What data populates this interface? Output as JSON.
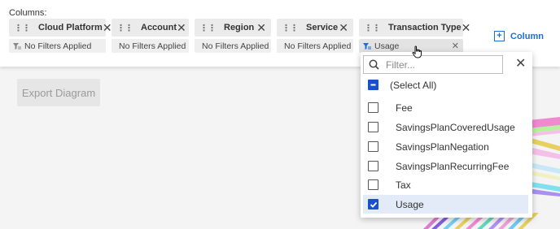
{
  "header": {
    "columns_label": "Columns:"
  },
  "columns": [
    {
      "label": "Cloud Platform",
      "filter": "No Filters Applied"
    },
    {
      "label": "Account",
      "filter": "No Filters Applied"
    },
    {
      "label": "Region",
      "filter": "No Filters Applied"
    },
    {
      "label": "Service",
      "filter": "No Filters Applied"
    },
    {
      "label": "Transaction Type",
      "filter": "Usage"
    }
  ],
  "add_column_label": "Column",
  "export_label": "Export Diagram",
  "dropdown": {
    "search_placeholder": "Filter...",
    "select_all": "(Select All)",
    "options": [
      {
        "label": "Fee",
        "checked": false
      },
      {
        "label": "SavingsPlanCoveredUsage",
        "checked": false
      },
      {
        "label": "SavingsPlanNegation",
        "checked": false
      },
      {
        "label": "SavingsPlanRecurringFee",
        "checked": false
      },
      {
        "label": "Tax",
        "checked": false
      },
      {
        "label": "Usage",
        "checked": true
      }
    ]
  },
  "colors": {
    "accent": "#1a6fd6",
    "checkbox": "#1a4fcf",
    "selected_row": "#e3ebf8"
  }
}
